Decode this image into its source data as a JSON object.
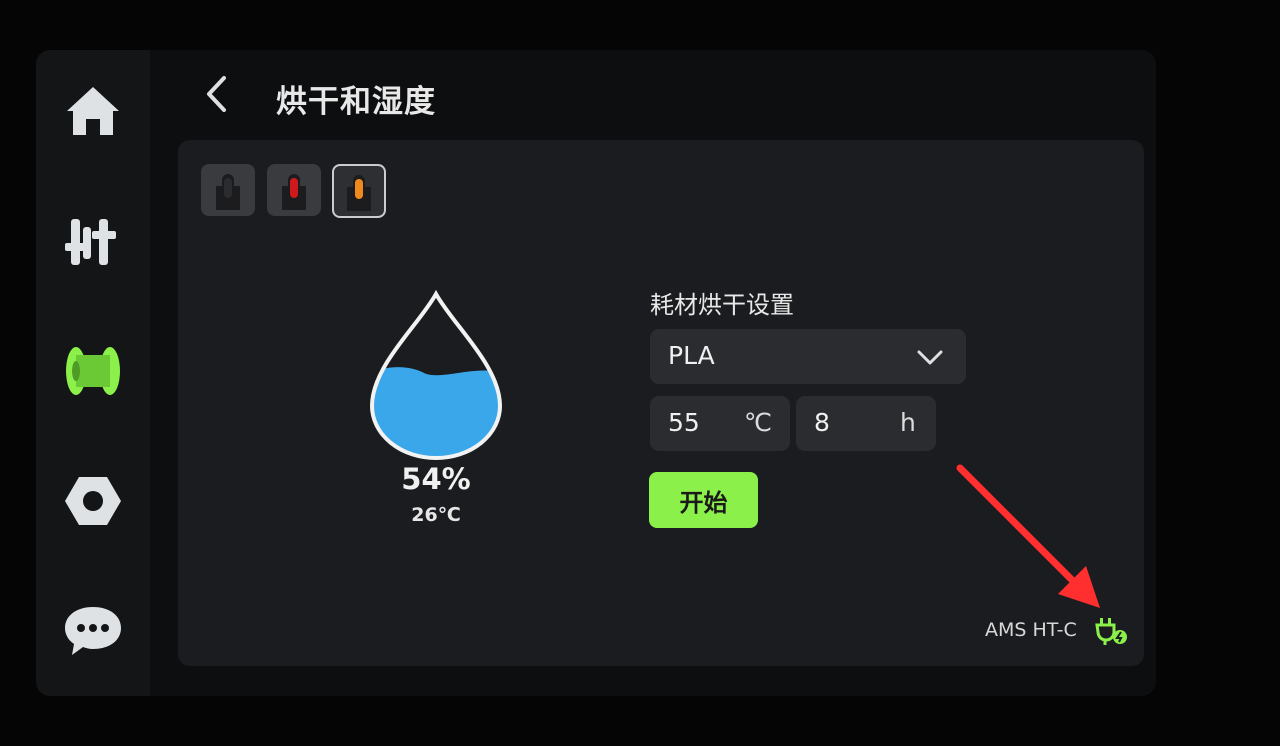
{
  "header": {
    "title": "烘干和湿度",
    "back_icon": "chevron-left-icon"
  },
  "sidebar": {
    "items": [
      {
        "name": "home",
        "icon": "home-icon",
        "active": false
      },
      {
        "name": "controls",
        "icon": "sliders-icon",
        "active": false
      },
      {
        "name": "filament",
        "icon": "spool-icon",
        "active": true
      },
      {
        "name": "settings",
        "icon": "hex-nut-icon",
        "active": false
      },
      {
        "name": "messages",
        "icon": "chat-bubble-icon",
        "active": false
      }
    ]
  },
  "slots": [
    {
      "color": "#2b2c2f",
      "selected": false
    },
    {
      "color": "#d0191d",
      "selected": false
    },
    {
      "color": "#f08a1c",
      "selected": true
    }
  ],
  "status": {
    "humidity": "54%",
    "temperature": "26℃",
    "fill_level": 0.54
  },
  "drying": {
    "title": "耗材烘干设置",
    "material": "PLA",
    "temperature": "55",
    "temperature_unit": "℃",
    "duration": "8",
    "duration_unit": "h",
    "start_label": "开始"
  },
  "device": {
    "name": "AMS HT-C",
    "power_icon": "plug-icon"
  },
  "colors": {
    "accent": "#8cf04a",
    "water": "#3aa7ea",
    "annotation": "#ff2f2f"
  }
}
